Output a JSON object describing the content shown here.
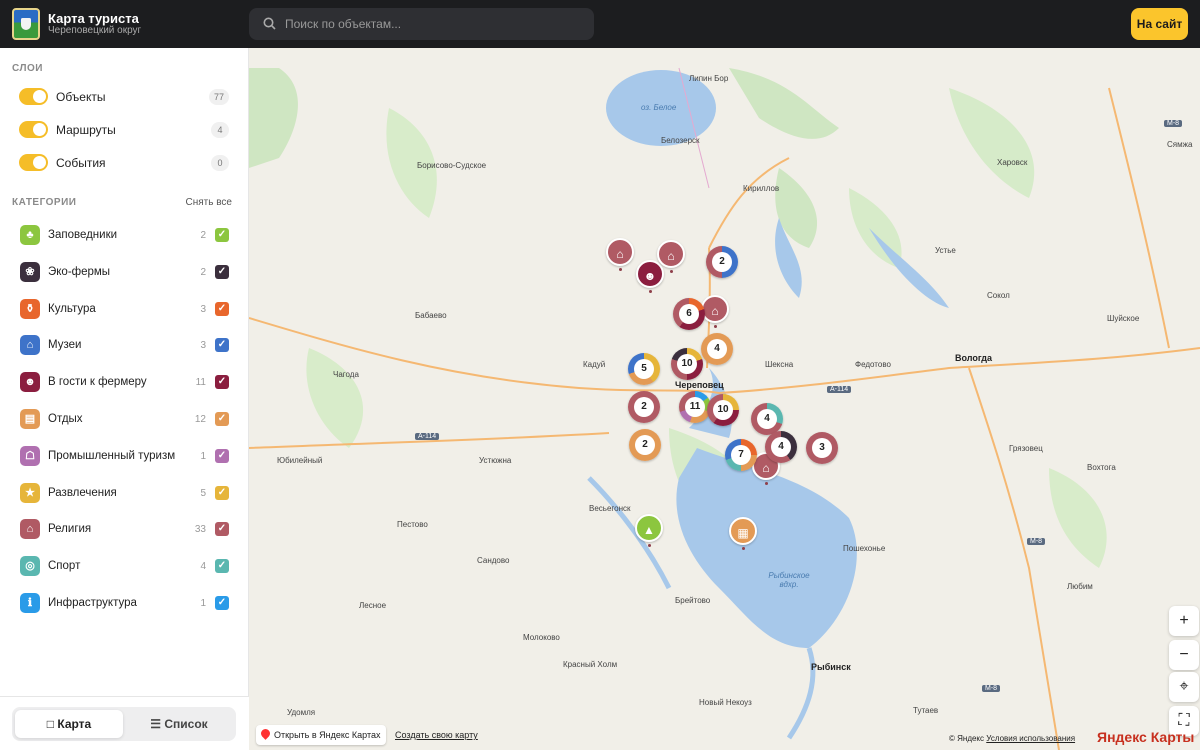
{
  "header": {
    "title": "Карта туриста",
    "subtitle": "Череповецкий округ",
    "search_placeholder": "Поиск по объектам...",
    "site_button": "На сайт"
  },
  "sidebar": {
    "layers_heading": "СЛОИ",
    "layers": [
      {
        "label": "Объекты",
        "count": "77",
        "on": true
      },
      {
        "label": "Маршруты",
        "count": "4",
        "on": true
      },
      {
        "label": "События",
        "count": "0",
        "on": true
      }
    ],
    "categories_heading": "КАТЕГОРИИ",
    "clear_all": "Снять все",
    "categories": [
      {
        "label": "Заповедники",
        "count": "2",
        "color": "#8cc63f",
        "icon": "tree-icon"
      },
      {
        "label": "Эко-фермы",
        "count": "2",
        "color": "#3b2f3d",
        "icon": "paw-icon"
      },
      {
        "label": "Культура",
        "count": "3",
        "color": "#e8662c",
        "icon": "vase-icon"
      },
      {
        "label": "Музеи",
        "count": "3",
        "color": "#3e73c9",
        "icon": "museum-icon"
      },
      {
        "label": "В гости к фермеру",
        "count": "11",
        "color": "#8b1e3f",
        "icon": "farmer-icon"
      },
      {
        "label": "Отдых",
        "count": "12",
        "color": "#e39a55",
        "icon": "bed-icon"
      },
      {
        "label": "Промышленный туризм",
        "count": "1",
        "color": "#b070b0",
        "icon": "factory-icon"
      },
      {
        "label": "Развлечения",
        "count": "5",
        "color": "#e6b53a",
        "icon": "party-icon"
      },
      {
        "label": "Религия",
        "count": "33",
        "color": "#b05a64",
        "icon": "church-icon"
      },
      {
        "label": "Спорт",
        "count": "4",
        "color": "#5ab7b0",
        "icon": "ball-icon"
      },
      {
        "label": "Инфраструктура",
        "count": "1",
        "color": "#2a9be8",
        "icon": "info-icon"
      }
    ],
    "view_tabs": {
      "map": "Карта",
      "list": "Список"
    }
  },
  "map": {
    "places": [
      {
        "name": "Липин Бор"
      },
      {
        "name": "Белозерск"
      },
      {
        "name": "Борисово-Судское"
      },
      {
        "name": "Кириллов"
      },
      {
        "name": "Харовск"
      },
      {
        "name": "Сямжа"
      },
      {
        "name": "Устье"
      },
      {
        "name": "Сокол"
      },
      {
        "name": "Шуйское"
      },
      {
        "name": "Бабаево"
      },
      {
        "name": "Вологда"
      },
      {
        "name": "Кадуй"
      },
      {
        "name": "Шексна"
      },
      {
        "name": "Федотово"
      },
      {
        "name": "Череповец"
      },
      {
        "name": "Чагода"
      },
      {
        "name": "Грязовец"
      },
      {
        "name": "Вохтога"
      },
      {
        "name": "Юбилейный"
      },
      {
        "name": "Устюжна"
      },
      {
        "name": "Весьегонск"
      },
      {
        "name": "Пестово"
      },
      {
        "name": "Сандово"
      },
      {
        "name": "Пошехонье"
      },
      {
        "name": "Лесное"
      },
      {
        "name": "Брейтово"
      },
      {
        "name": "Любим"
      },
      {
        "name": "Молоково"
      },
      {
        "name": "Красный Холм"
      },
      {
        "name": "Рыбинск"
      },
      {
        "name": "Новый Некоуз"
      },
      {
        "name": "Удомля"
      },
      {
        "name": "Тутаев"
      }
    ],
    "water_labels": [
      "оз. Белое",
      "Рыбинское вдхр."
    ],
    "roads": [
      "А-114",
      "А-114",
      "М-8",
      "М-8",
      "М-8"
    ],
    "clusters": [
      "2",
      "6",
      "4",
      "10",
      "5",
      "2",
      "11",
      "10",
      "4",
      "2",
      "7",
      "4",
      "3"
    ],
    "open_in_yandex": "Открыть в Яндекс Картах",
    "create_map": "Создать свою карту",
    "copyright": "© Яндекс",
    "terms": "Условия использования",
    "logo": "Яндекс Карты"
  }
}
